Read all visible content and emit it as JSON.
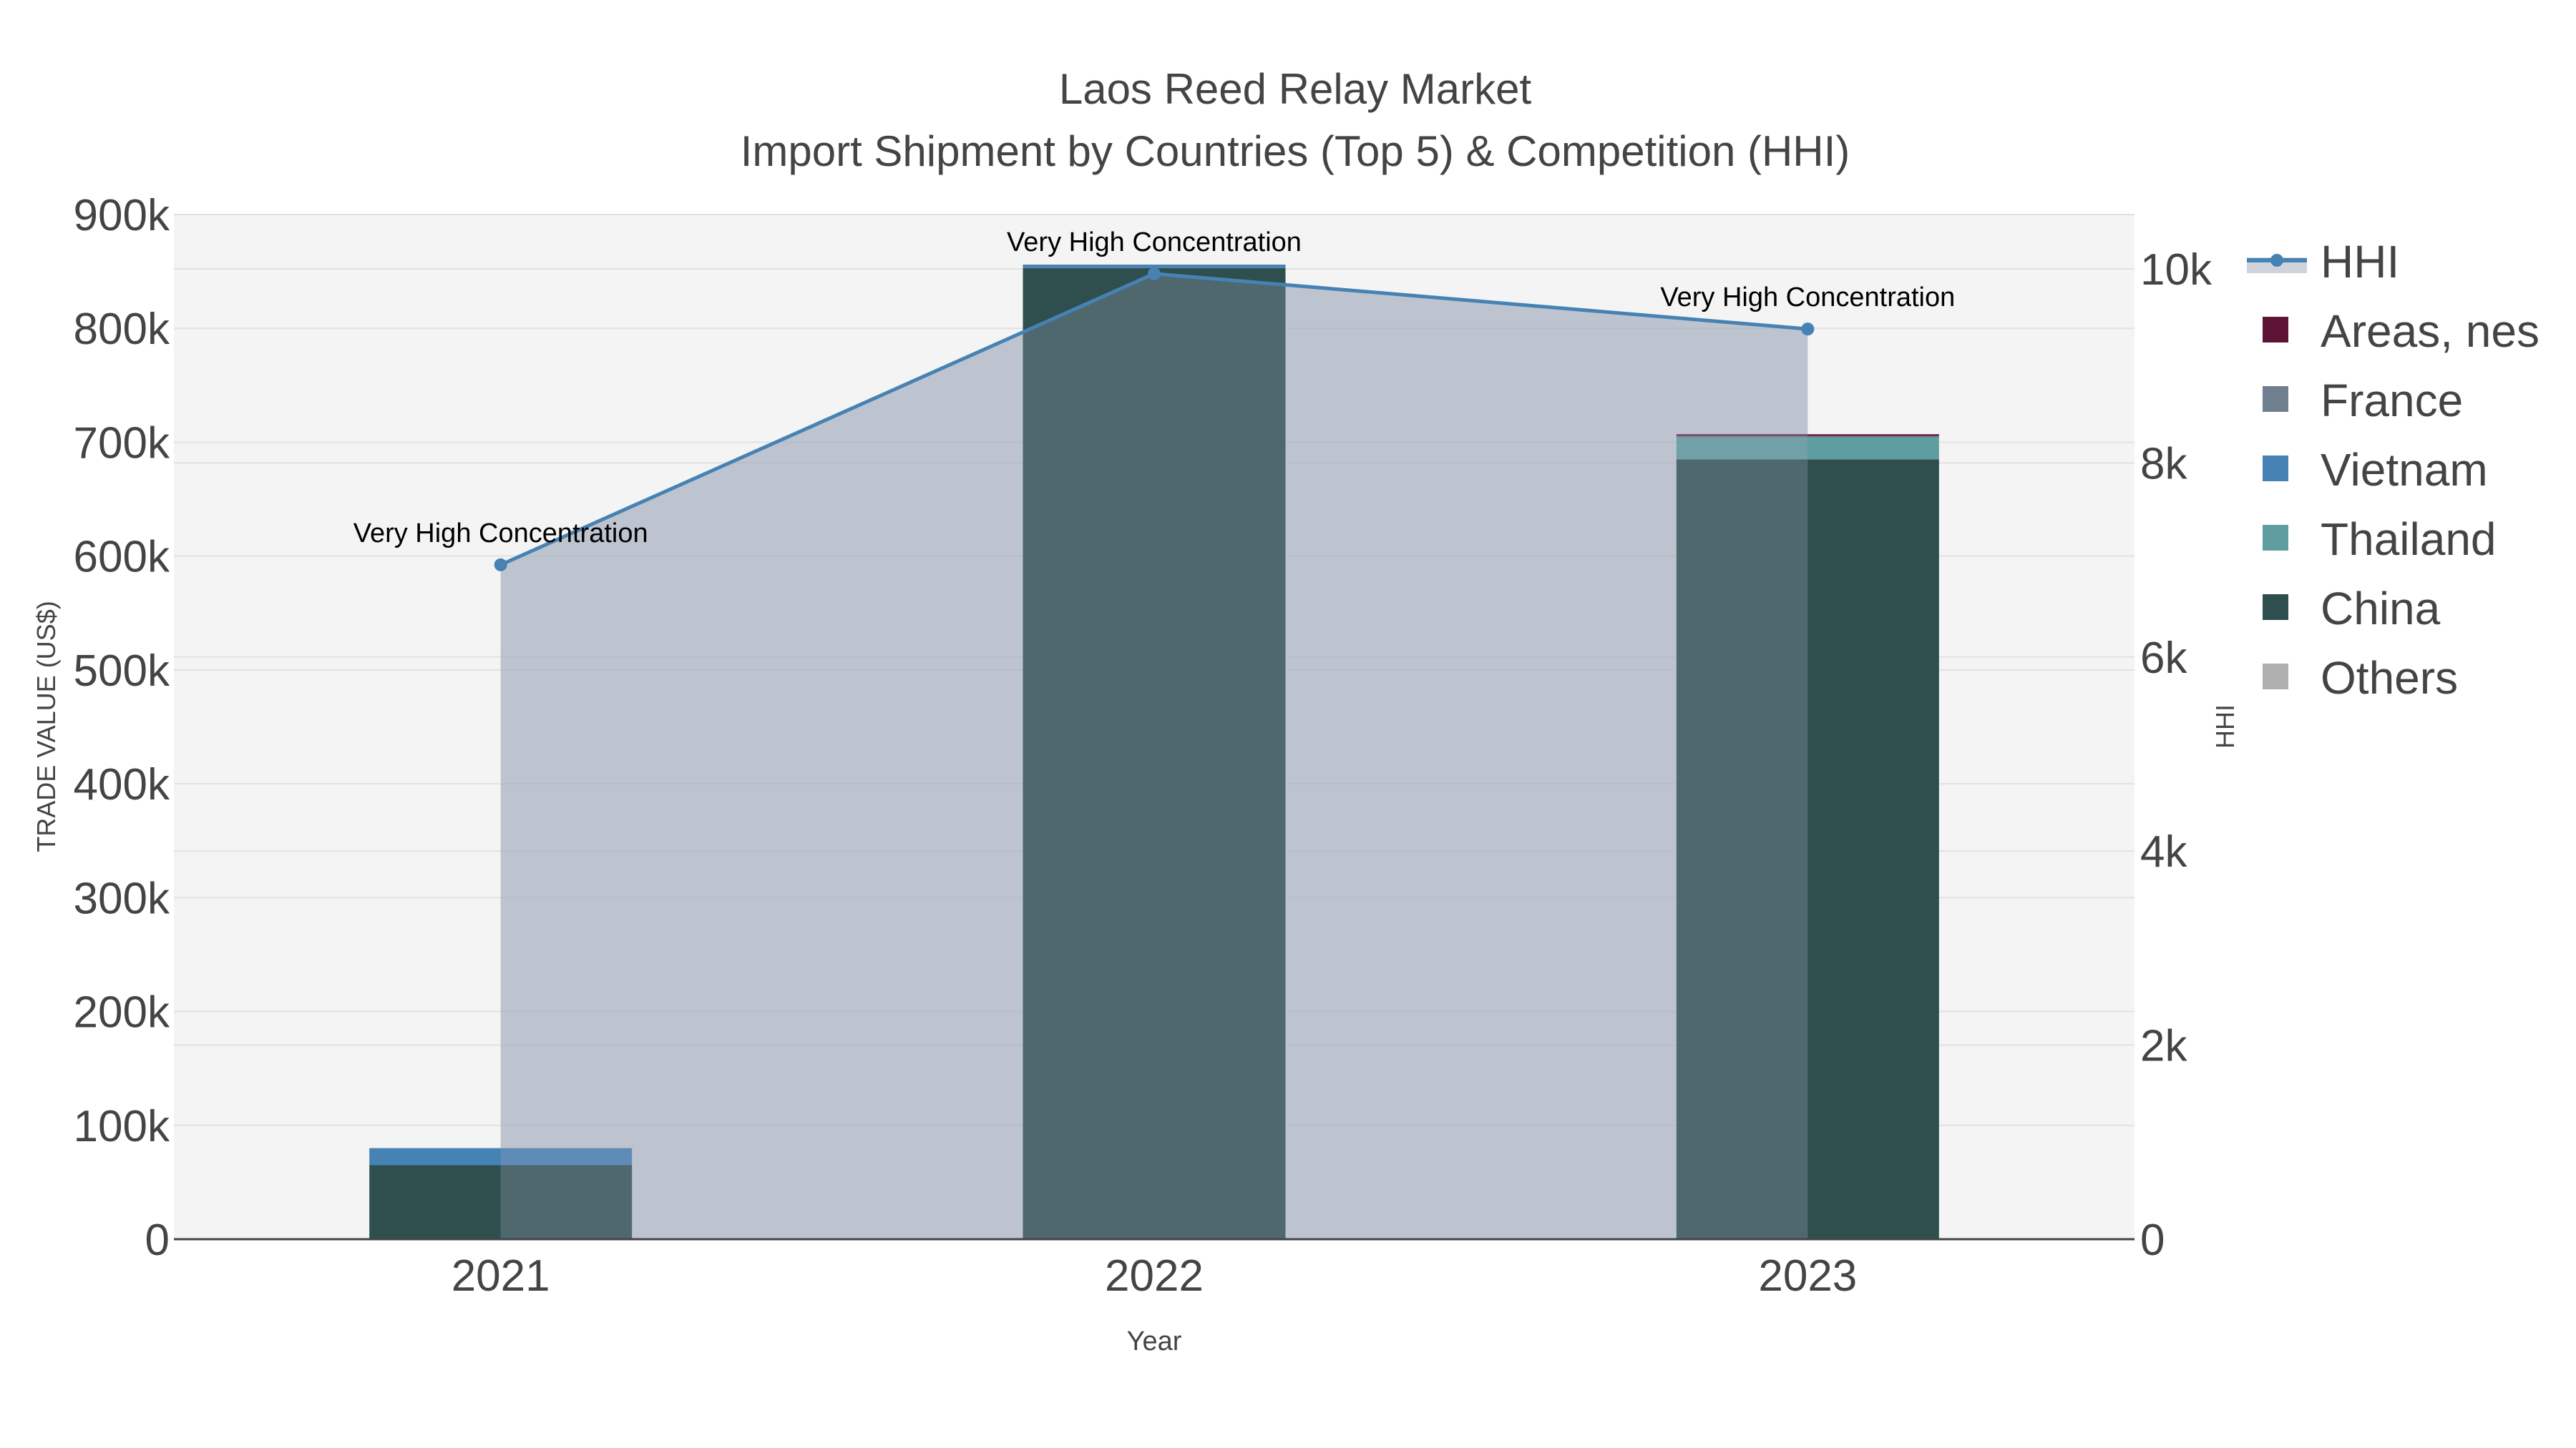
{
  "chart_data": {
    "type": "bar",
    "title": "Laos Reed Relay Market",
    "subtitle": "Import Shipment by Countries (Top 5) & Competition (HHI)",
    "xlabel": "Year",
    "ylabel": "TRADE VALUE (US$)",
    "y2label": "HHI",
    "categories": [
      "2021",
      "2022",
      "2023"
    ],
    "ylim": [
      0,
      900000
    ],
    "y2lim": [
      0,
      10560
    ],
    "yticks": [
      0,
      100000,
      200000,
      300000,
      400000,
      500000,
      600000,
      700000,
      800000,
      900000
    ],
    "ytick_labels": [
      "0",
      "100k",
      "200k",
      "300k",
      "400k",
      "500k",
      "600k",
      "700k",
      "800k",
      "900k"
    ],
    "y2ticks": [
      0,
      2000,
      4000,
      6000,
      8000,
      10000
    ],
    "y2tick_labels": [
      "0",
      "2k",
      "4k",
      "6k",
      "8k",
      "10k"
    ],
    "grid": true,
    "barmode": "stack",
    "series": [
      {
        "name": "China",
        "color": "#2f4f4f",
        "values": [
          65000,
          853000,
          685000
        ]
      },
      {
        "name": "Thailand",
        "color": "#5f9ea0",
        "values": [
          0,
          0,
          19000
        ]
      },
      {
        "name": "Vietnam",
        "color": "#4682b4",
        "values": [
          15000,
          3000,
          0
        ]
      },
      {
        "name": "France",
        "color": "#708090",
        "values": [
          0,
          0,
          1500
        ]
      },
      {
        "name": "Areas, nes",
        "color": "#5e1437",
        "values": [
          0,
          0,
          1500
        ]
      },
      {
        "name": "Others",
        "color": "#b0b0b0",
        "values": [
          0,
          0,
          0
        ]
      }
    ],
    "hhi": {
      "name": "HHI",
      "color": "#4682b4",
      "values": [
        6950,
        9950,
        9380
      ],
      "annotations": [
        "Very High Concentration",
        "Very High Concentration",
        "Very High Concentration"
      ]
    },
    "legend": [
      "HHI",
      "Areas, nes",
      "France",
      "Vietnam",
      "Thailand",
      "China",
      "Others"
    ],
    "legend_placement": "right"
  }
}
